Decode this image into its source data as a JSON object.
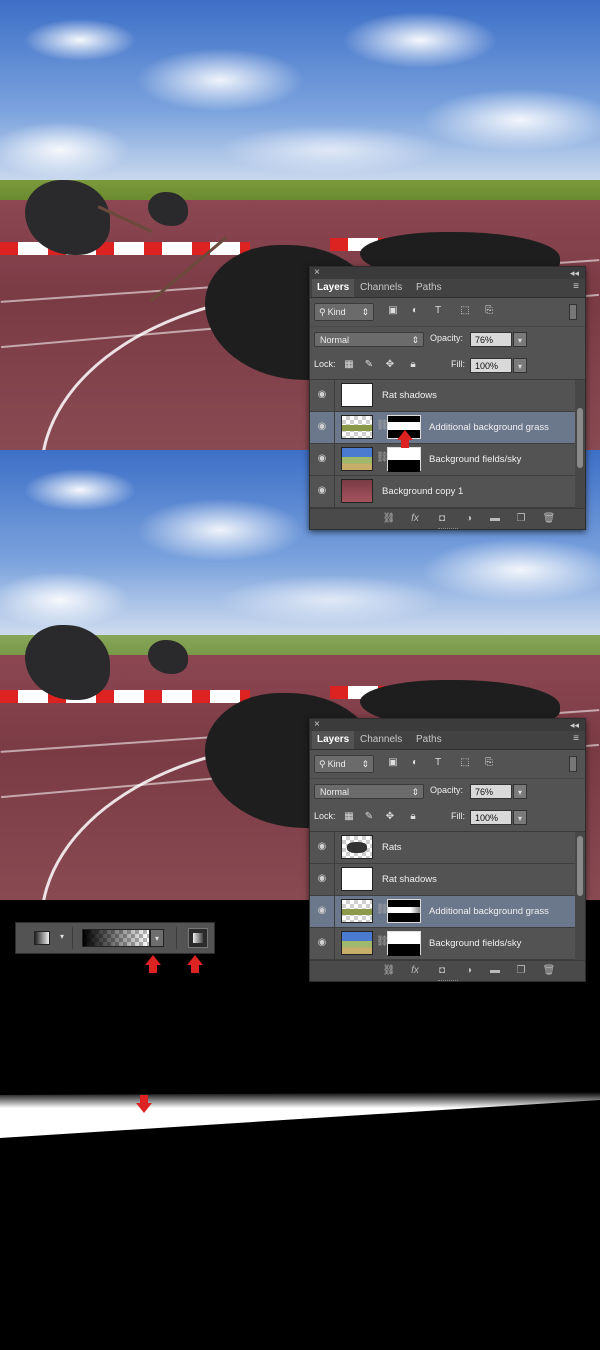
{
  "panel_top": {
    "tabs": [
      "Layers",
      "Channels",
      "Paths"
    ],
    "filter_kind": "Kind",
    "blend_mode": "Normal",
    "opacity_label": "Opacity:",
    "opacity_value": "76%",
    "lock_label": "Lock:",
    "fill_label": "Fill:",
    "fill_value": "100%",
    "layers": [
      {
        "name": "Rat shadows",
        "selected": false
      },
      {
        "name": "Additional background grass",
        "selected": true
      },
      {
        "name": "Background fields/sky",
        "selected": false
      },
      {
        "name": "Background copy 1",
        "selected": false
      }
    ]
  },
  "panel_bottom": {
    "tabs": [
      "Layers",
      "Channels",
      "Paths"
    ],
    "filter_kind": "Kind",
    "blend_mode": "Normal",
    "opacity_label": "Opacity:",
    "opacity_value": "76%",
    "lock_label": "Lock:",
    "fill_label": "Fill:",
    "fill_value": "100%",
    "layers": [
      {
        "name": "Rats",
        "selected": false
      },
      {
        "name": "Rat shadows",
        "selected": false
      },
      {
        "name": "Additional background grass",
        "selected": true
      },
      {
        "name": "Background fields/sky",
        "selected": false
      }
    ]
  },
  "footer_fx": "fx",
  "colors": {
    "panel_bg": "#535353",
    "selected_layer": "#6b778a",
    "arrow": "#dd2222"
  },
  "icons": [
    "search-icon",
    "image-filter-icon",
    "adjustment-filter-icon",
    "type-filter-icon",
    "shape-filter-icon",
    "smart-object-filter-icon",
    "eye-icon",
    "link-icon",
    "fx-icon",
    "mask-icon",
    "new-group-icon",
    "new-layer-icon",
    "trash-icon",
    "linear-gradient-icon"
  ]
}
